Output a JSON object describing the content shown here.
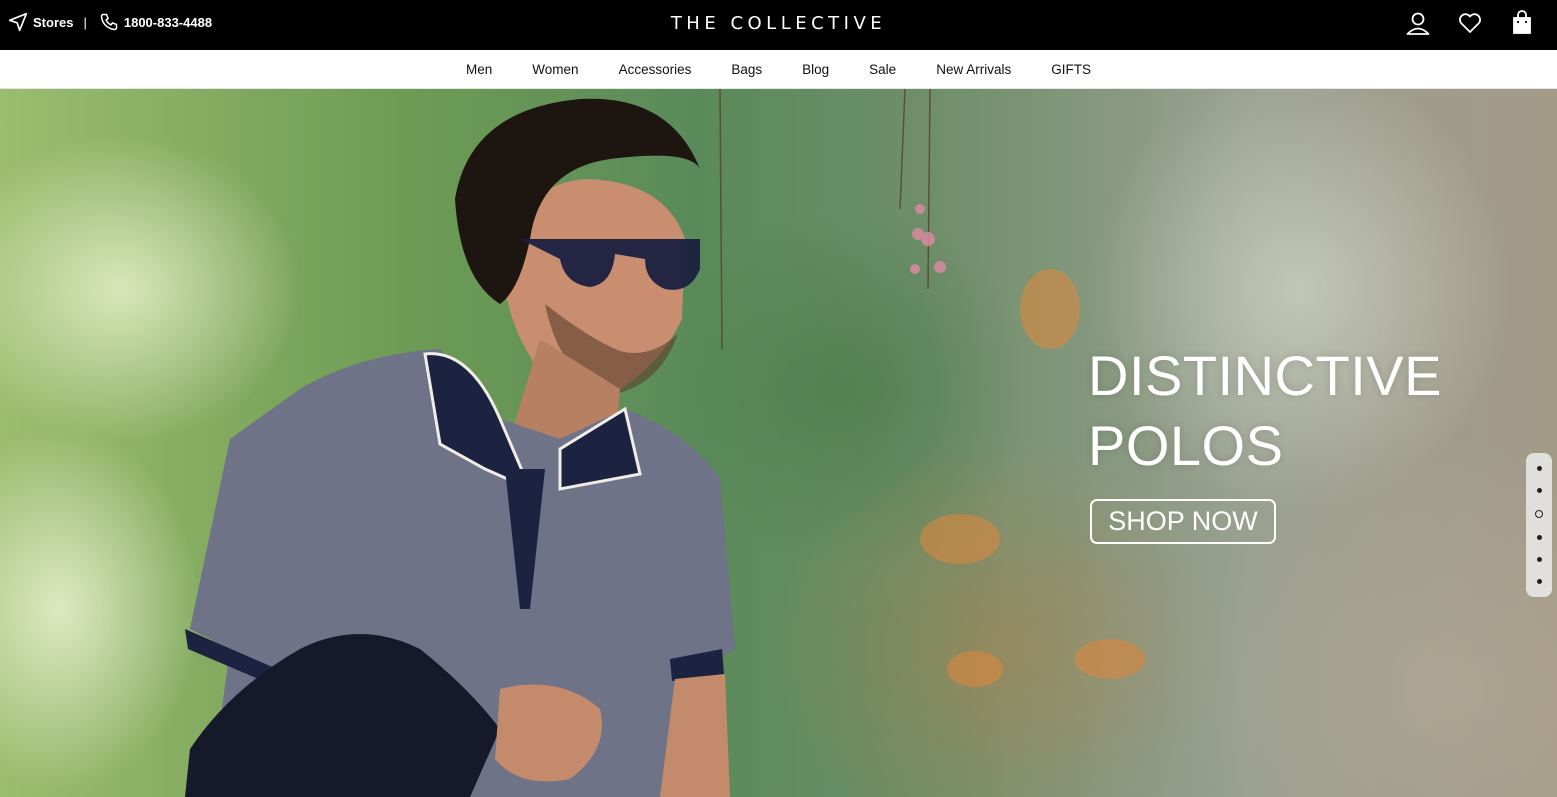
{
  "topbar": {
    "stores_label": "Stores",
    "separator": "|",
    "phone": "1800-833-4488",
    "brand": "THE COLLECTIVE",
    "icons": [
      "account-icon",
      "wishlist-heart-icon",
      "shopping-bag-icon"
    ]
  },
  "nav": {
    "items": [
      "Men",
      "Women",
      "Accessories",
      "Bags",
      "Blog",
      "Sale",
      "New Arrivals",
      "GIFTS"
    ]
  },
  "hero": {
    "headline_line1": "DISTINCTIVE",
    "headline_line2": "POLOS",
    "cta_label": "SHOP NOW",
    "slide_count": 6,
    "active_slide": 3
  },
  "colors": {
    "topbar_bg": "#000000",
    "text_on_dark": "#ffffff",
    "nav_text": "#111111"
  }
}
